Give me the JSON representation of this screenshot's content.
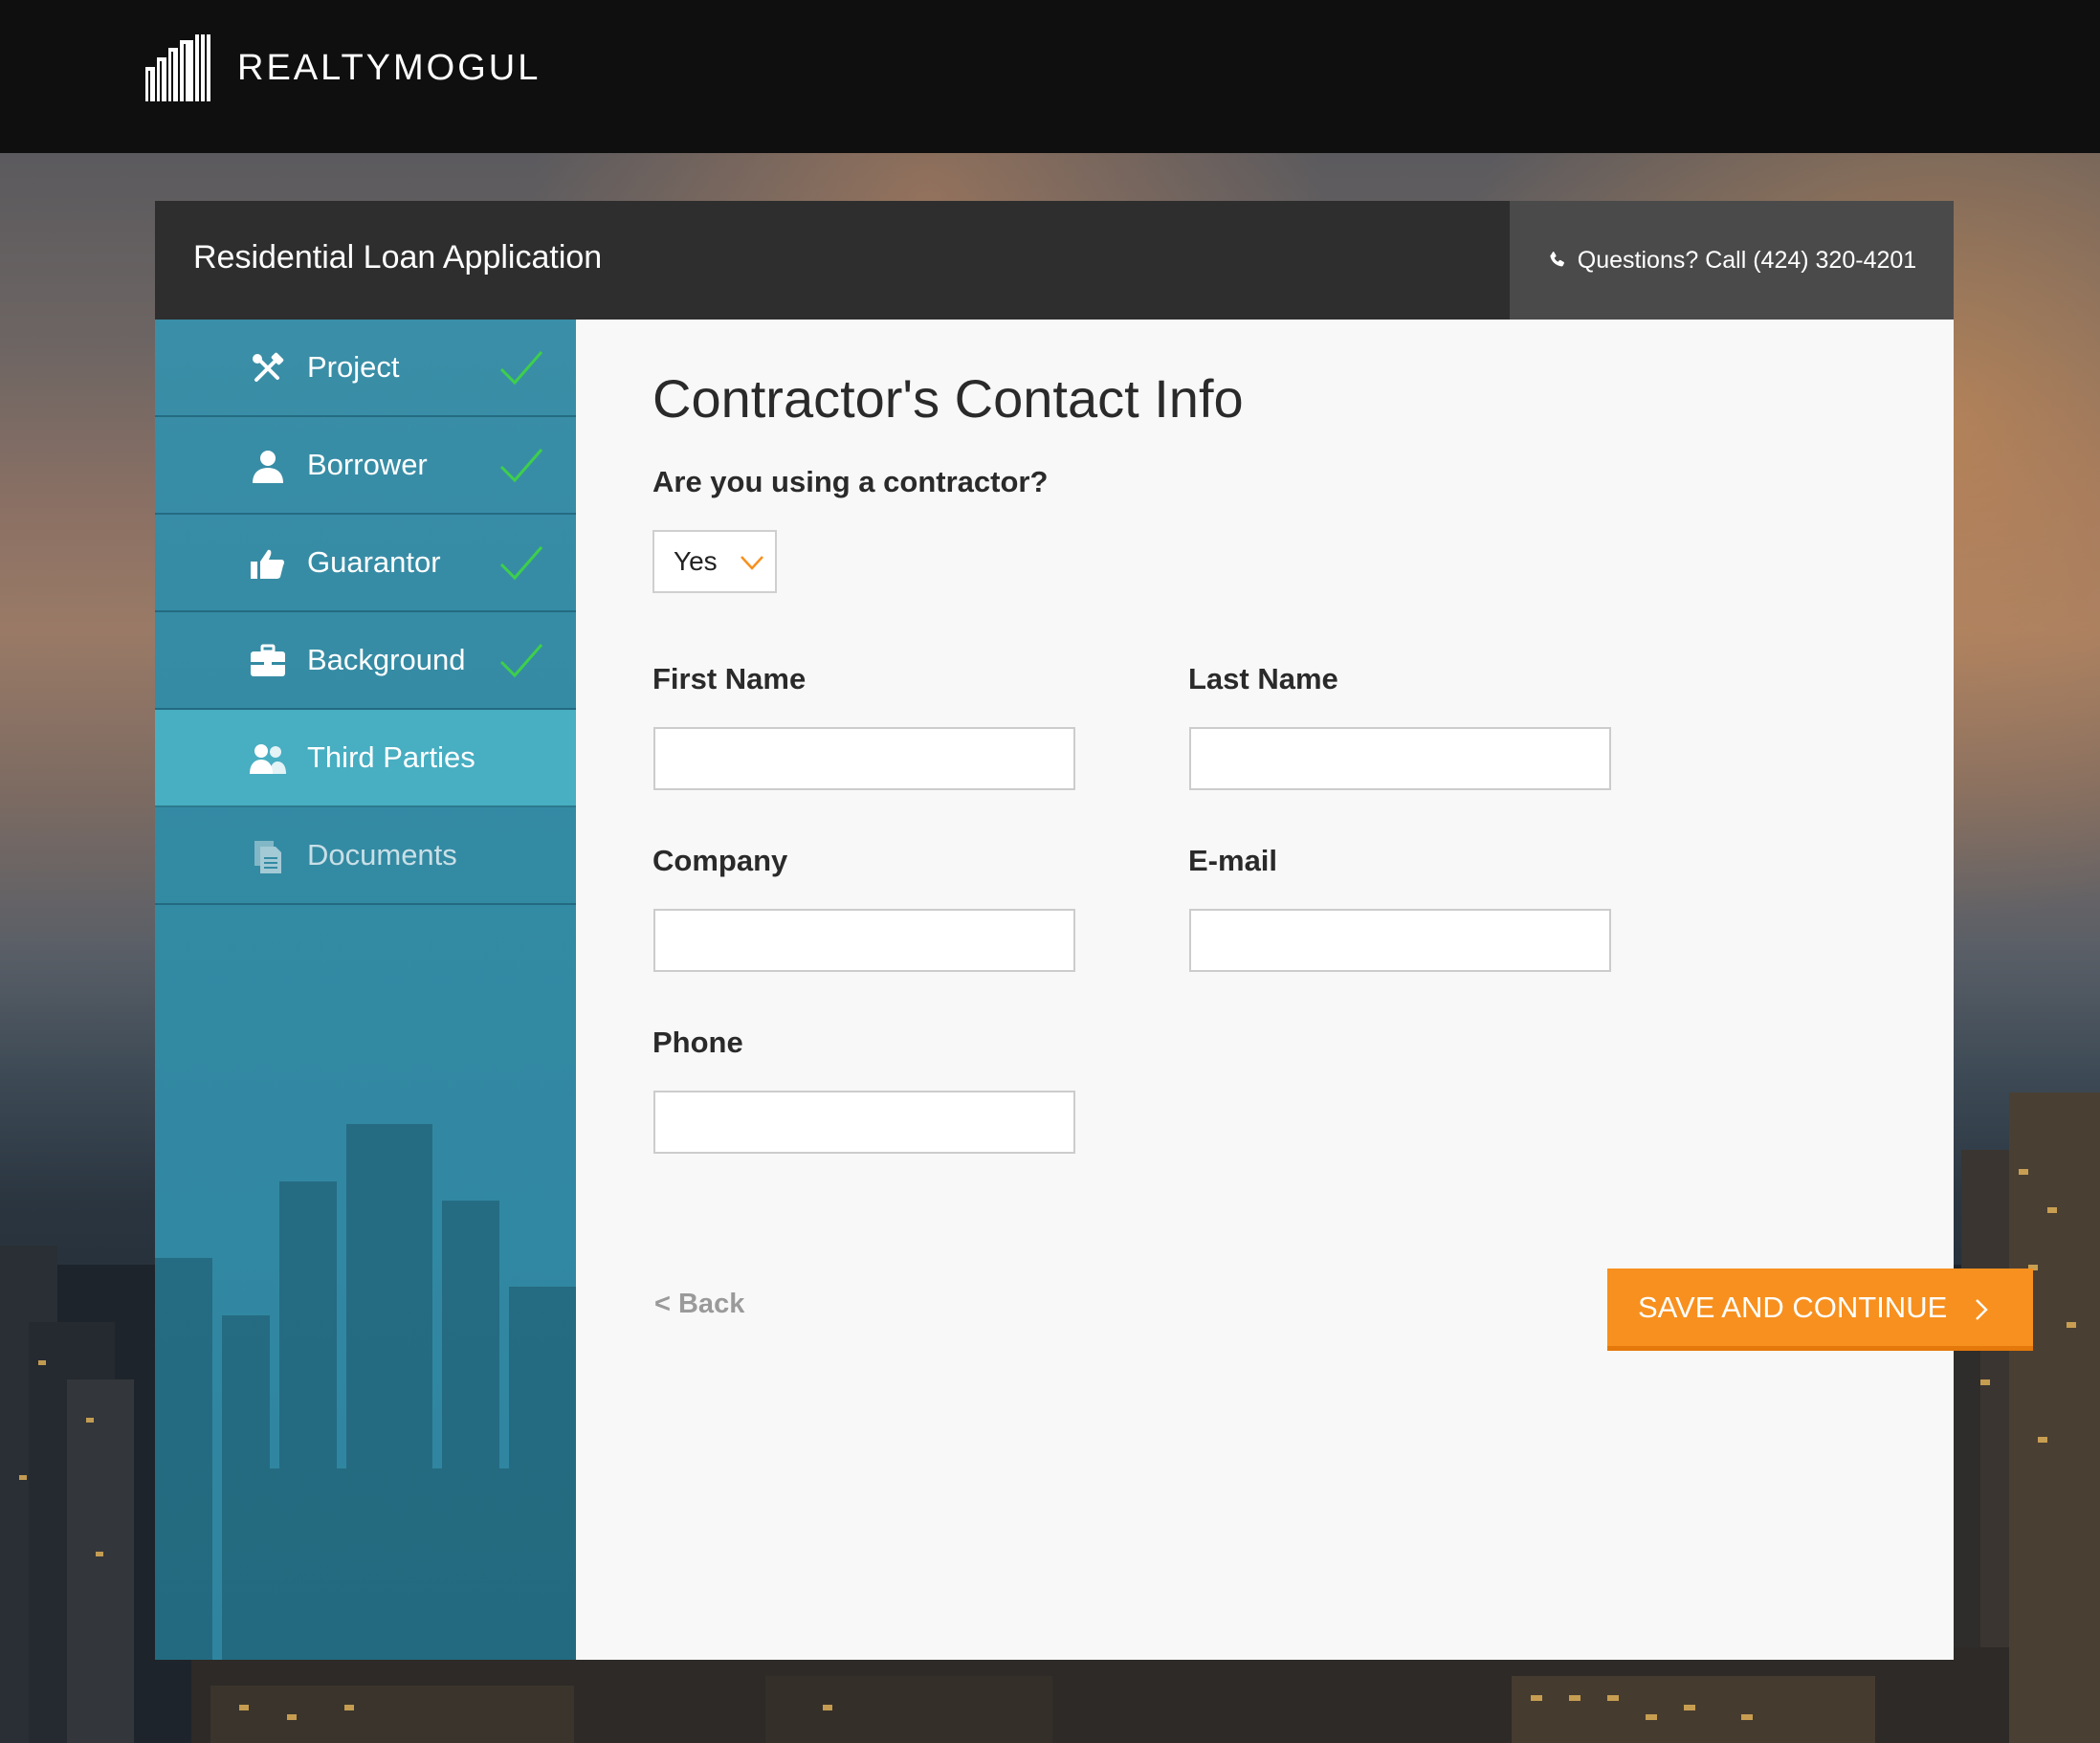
{
  "brand": {
    "name": "REALTYMOGUL"
  },
  "header": {
    "title": "Residential Loan Application",
    "help_text": "Questions? Call (424) 320-4201"
  },
  "sidebar": {
    "items": [
      {
        "label": "Project",
        "icon": "tools-icon",
        "completed": true,
        "active": false
      },
      {
        "label": "Borrower",
        "icon": "person-icon",
        "completed": true,
        "active": false
      },
      {
        "label": "Guarantor",
        "icon": "thumbs-up-icon",
        "completed": true,
        "active": false
      },
      {
        "label": "Background",
        "icon": "briefcase-icon",
        "completed": true,
        "active": false
      },
      {
        "label": "Third Parties",
        "icon": "people-icon",
        "completed": false,
        "active": true
      },
      {
        "label": "Documents",
        "icon": "documents-icon",
        "completed": false,
        "active": false
      }
    ]
  },
  "form": {
    "title": "Contractor's Contact Info",
    "question": "Are you using a contractor?",
    "contractor_select": {
      "value": "Yes"
    },
    "fields": {
      "first_name": {
        "label": "First Name",
        "value": ""
      },
      "last_name": {
        "label": "Last Name",
        "value": ""
      },
      "company": {
        "label": "Company",
        "value": ""
      },
      "email": {
        "label": "E-mail",
        "value": ""
      },
      "phone": {
        "label": "Phone",
        "value": ""
      }
    },
    "back_label": "< Back",
    "save_label": "SAVE AND CONTINUE"
  },
  "colors": {
    "accent": "#f7901e",
    "sidebar": "#338aa3",
    "sidebar_active": "#48aec2",
    "check": "#3ecf4b",
    "header": "#2e2e2e"
  }
}
